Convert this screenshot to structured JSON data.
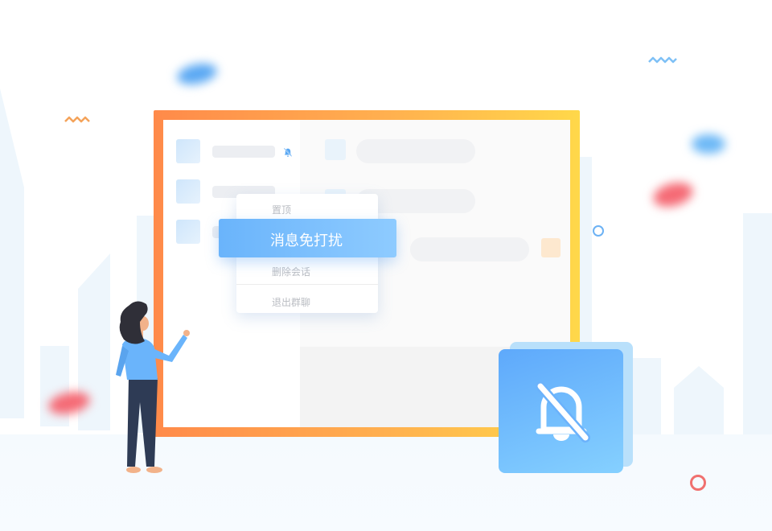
{
  "menu": {
    "items": [
      "置顶",
      "消息免打扰",
      "删除会话",
      "退出群聊"
    ],
    "selected_index": 1
  },
  "icons": {
    "chat_mute": "bell-off-icon",
    "feature_badge": "bell-off-icon"
  },
  "colors": {
    "frame_start": "#ff8a4a",
    "frame_end": "#ffd84a",
    "accent_blue": "#6ab4fb",
    "badge_blue": "#5ea9fb"
  }
}
